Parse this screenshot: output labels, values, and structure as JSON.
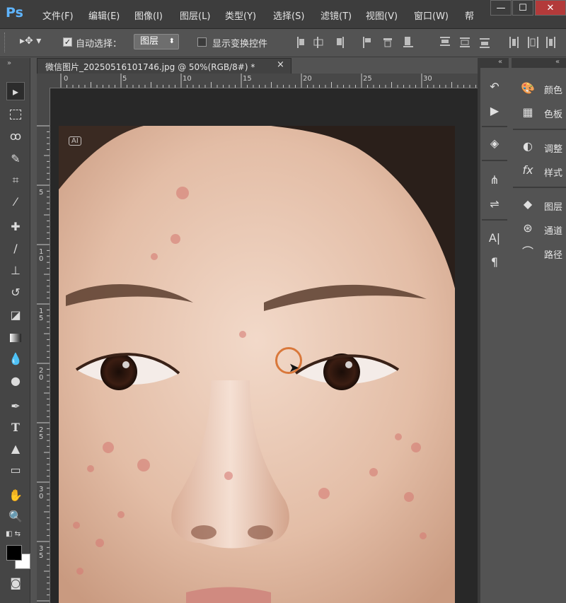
{
  "app": {
    "logo": "Ps"
  },
  "menu": [
    "文件(F)",
    "编辑(E)",
    "图像(I)",
    "图层(L)",
    "类型(Y)",
    "选择(S)",
    "滤镜(T)",
    "视图(V)",
    "窗口(W)",
    "帮"
  ],
  "window_controls": {
    "minimize": "—",
    "maximize": "☐",
    "close": "✕"
  },
  "options_bar": {
    "auto_select_label": "自动选择：",
    "auto_select_checked": true,
    "auto_select_value": "图层",
    "show_transform_label": "显示变换控件",
    "show_transform_checked": false
  },
  "document": {
    "tab_title": "微信图片_20250516101746.jpg @ 50%(RGB/8#) *",
    "close": "×"
  },
  "ruler_top_ticks": [
    "0",
    "5",
    "10",
    "15",
    "20",
    "25",
    "30"
  ],
  "ruler_left_ticks": [
    "5",
    "10",
    "15",
    "20",
    "25",
    "30",
    "35"
  ],
  "panels": [
    {
      "label": "颜色",
      "icon": "palette-icon"
    },
    {
      "label": "色板",
      "icon": "swatches-icon"
    },
    {
      "label": "调整",
      "icon": "adjustments-icon"
    },
    {
      "label": "样式",
      "icon": "styles-icon"
    },
    {
      "label": "图层",
      "icon": "layers-icon"
    },
    {
      "label": "通道",
      "icon": "channels-icon"
    },
    {
      "label": "路径",
      "icon": "paths-icon"
    }
  ],
  "canvas_badge": "AI",
  "colors": {
    "foreground": "#000000",
    "background": "#ffffff",
    "brush_circle": "#d9783b"
  }
}
